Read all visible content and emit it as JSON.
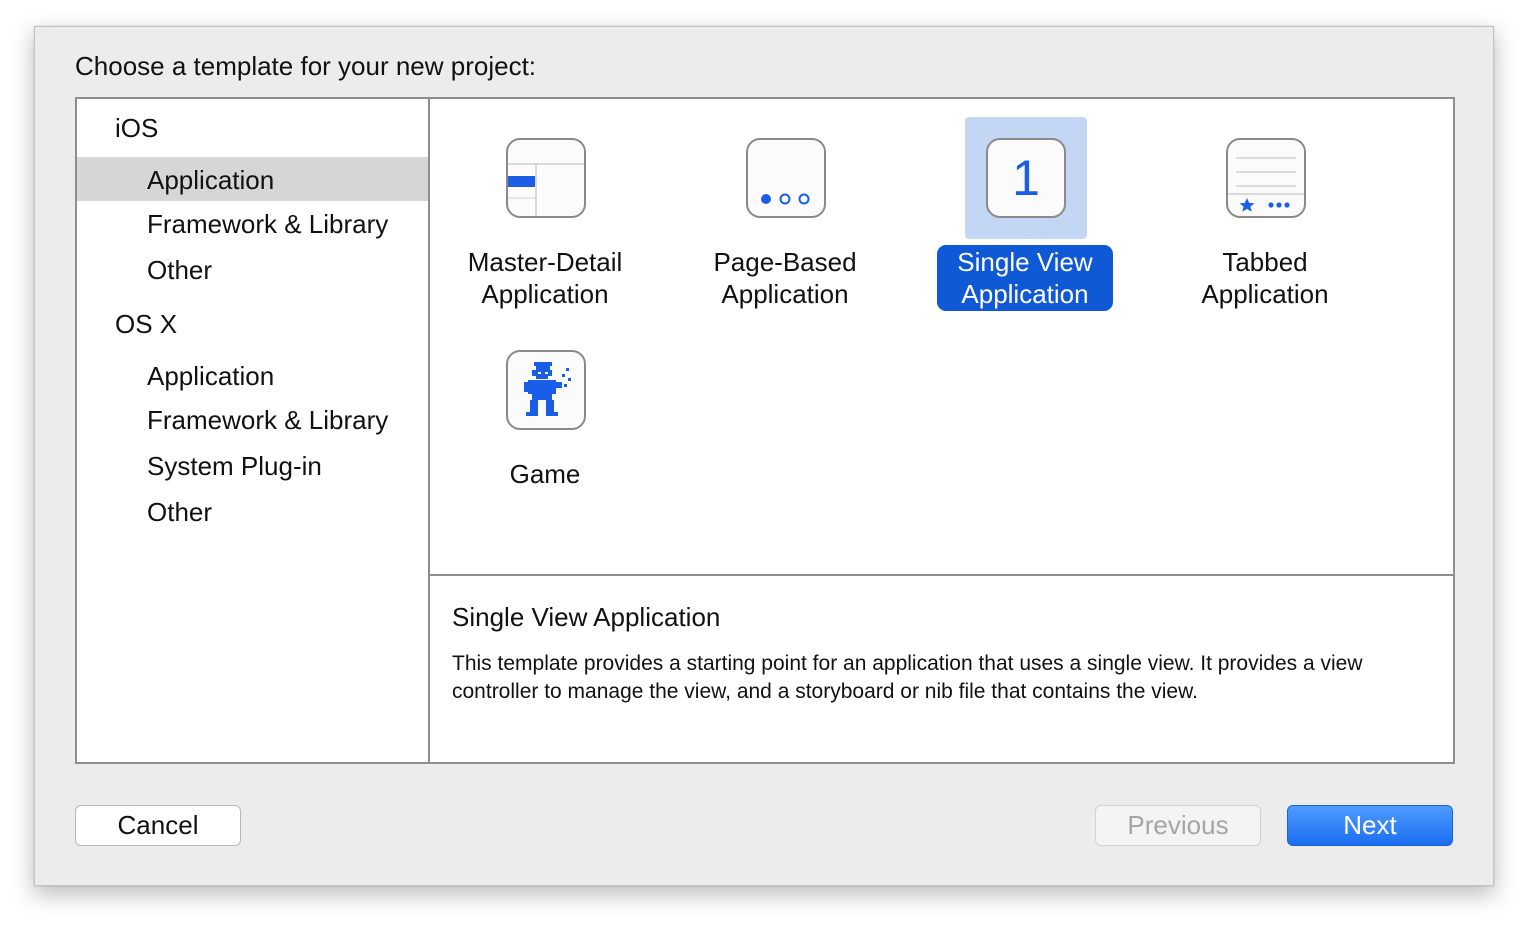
{
  "dialog": {
    "title": "Choose a template for your new project:"
  },
  "sidebar": {
    "groups": [
      {
        "label": "iOS",
        "items": [
          "Application",
          "Framework & Library",
          "Other"
        ]
      },
      {
        "label": "OS X",
        "items": [
          "Application",
          "Framework & Library",
          "System Plug-in",
          "Other"
        ]
      }
    ],
    "selected": "iOS / Application"
  },
  "templates": [
    {
      "line1": "Master-Detail",
      "line2": "Application",
      "icon": "master-detail-icon"
    },
    {
      "line1": "Page-Based",
      "line2": "Application",
      "icon": "page-based-icon"
    },
    {
      "line1": "Single View",
      "line2": "Application",
      "icon": "single-view-icon",
      "icon_text": "1",
      "selected": true
    },
    {
      "line1": "Tabbed",
      "line2": "Application",
      "icon": "tabbed-icon"
    },
    {
      "line1": "Game",
      "line2": "",
      "icon": "game-icon"
    }
  ],
  "description": {
    "title": "Single View Application",
    "body": "This template provides a starting point for an application that uses a single view. It provides a view controller to manage the view, and a storyboard or nib file that contains the view."
  },
  "buttons": {
    "cancel": "Cancel",
    "previous": "Previous",
    "next": "Next"
  },
  "colors": {
    "accent": "#0f58d6",
    "selection_tile": "#c3d6f3",
    "sidebar_selection": "#d6d6d6",
    "icon_blue": "#1a5ee8"
  }
}
